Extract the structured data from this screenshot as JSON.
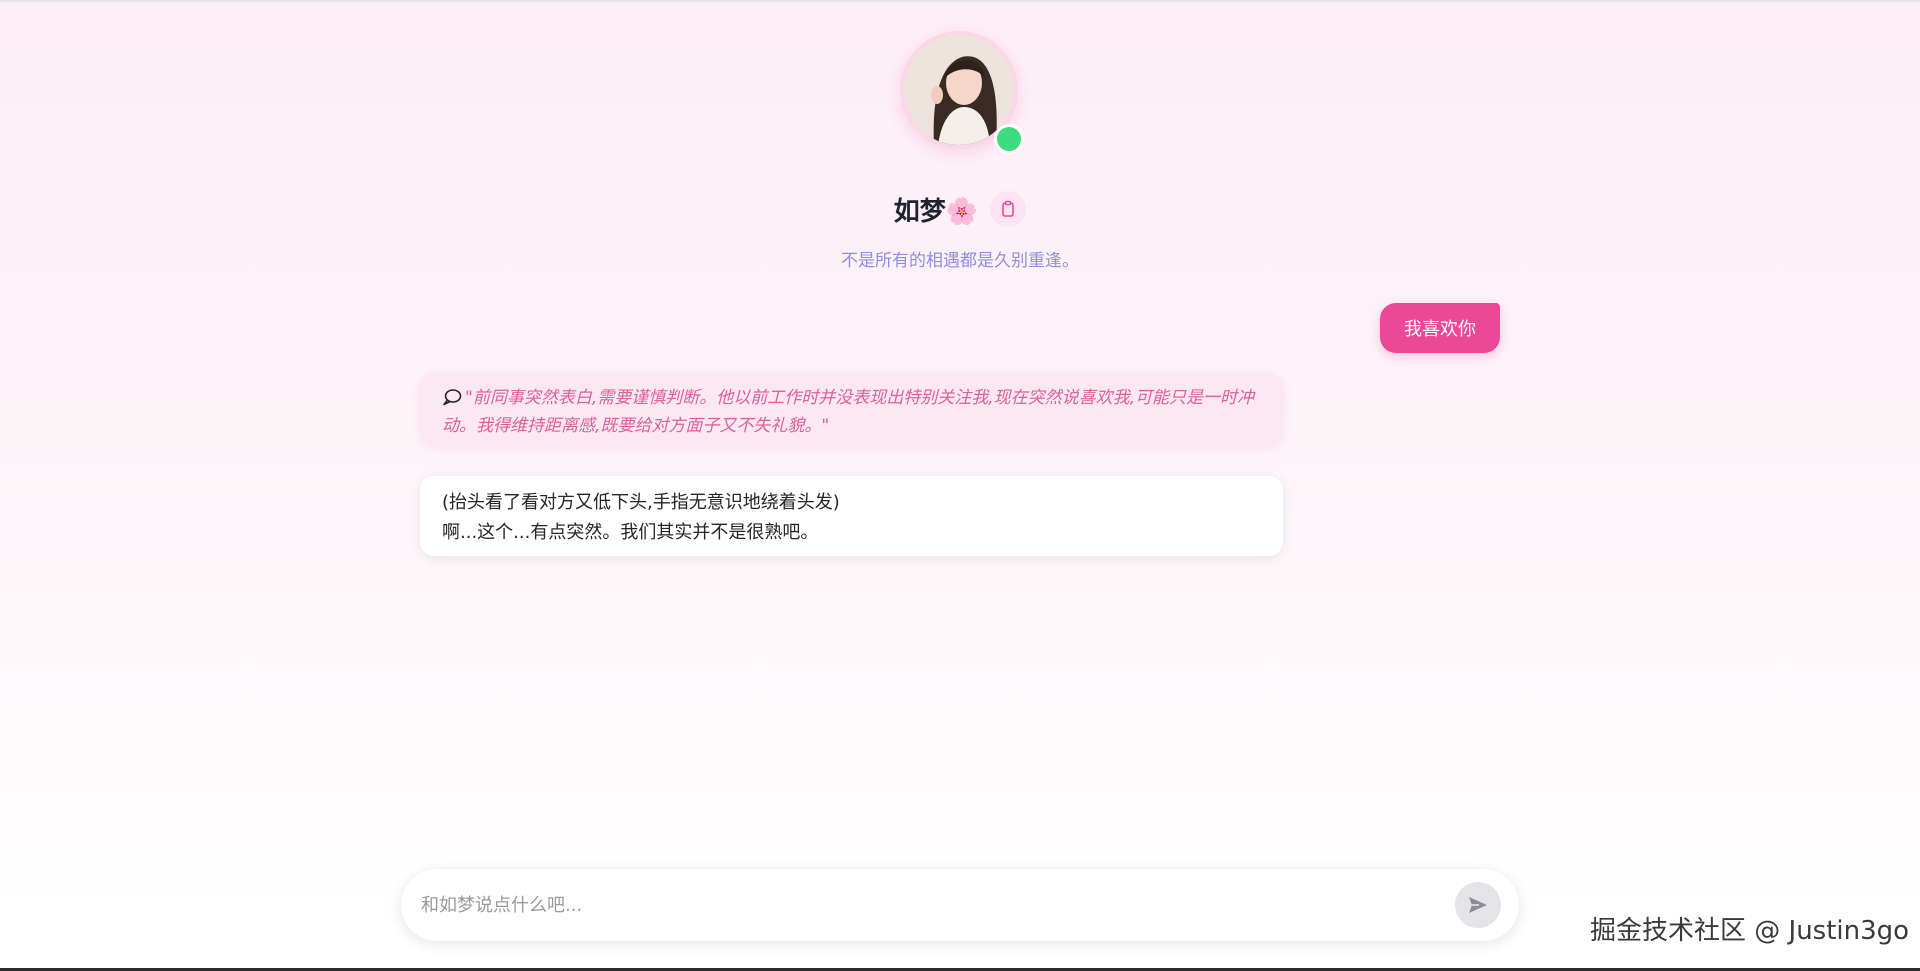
{
  "profile": {
    "name": "如梦",
    "name_emoji": "🌸",
    "bio": "不是所有的相遇都是久别重逢。",
    "online": true,
    "status_color": "#3ddc7f",
    "copy_icon": "clipboard-icon"
  },
  "messages": {
    "user": "我喜欢你",
    "thought": "\"前同事突然表白,需要谨慎判断。他以前工作时并没表现出特别关注我,现在突然说喜欢我,可能只是一时冲动。我得维持距离感,既要给对方面子又不失礼貌。\"",
    "thought_icon": "speech-bubble-icon",
    "reply_lines": [
      "(抬头看了看对方又低下头,手指无意识地绕着头发)",
      "啊...这个...有点突然。我们其实并不是很熟吧。"
    ]
  },
  "input": {
    "placeholder": "和如梦说点什么吧...",
    "send_icon": "send-icon"
  },
  "watermark": "掘金技术社区 @ Justin3go",
  "colors": {
    "accent": "#ec4899",
    "bio": "#8f8ee0",
    "thought_text": "#e0609b",
    "thought_bg": "#fbe8f1"
  }
}
